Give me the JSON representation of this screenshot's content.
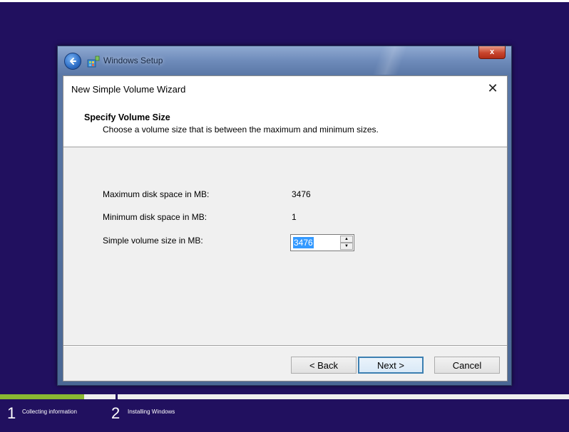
{
  "setup_window": {
    "title": "Windows Setup",
    "close_label": "x"
  },
  "wizard": {
    "title": "New Simple Volume Wizard",
    "close_glyph": "✕",
    "header": {
      "heading": "Specify Volume Size",
      "description": "Choose a volume size that is between the maximum and minimum sizes."
    },
    "fields": {
      "max_label": "Maximum disk space in MB:",
      "max_value": "3476",
      "min_label": "Minimum disk space in MB:",
      "min_value": "1",
      "size_label": "Simple volume size in MB:",
      "size_value": "3476"
    },
    "buttons": {
      "back": "< Back",
      "next": "Next >",
      "cancel": "Cancel"
    }
  },
  "progress": {
    "fraction": 0.148,
    "steps": [
      {
        "number": "1",
        "label": "Collecting information"
      },
      {
        "number": "2",
        "label": "Installing Windows"
      }
    ]
  },
  "colors": {
    "desktop": "#21105f",
    "progress_fill": "#8ab832",
    "selection": "#3399ff"
  },
  "icons": {
    "back": "back-arrow-icon",
    "setup": "windows-setup-icon",
    "close": "close-icon",
    "spin_up": "spin-up-icon",
    "spin_down": "spin-down-icon"
  }
}
